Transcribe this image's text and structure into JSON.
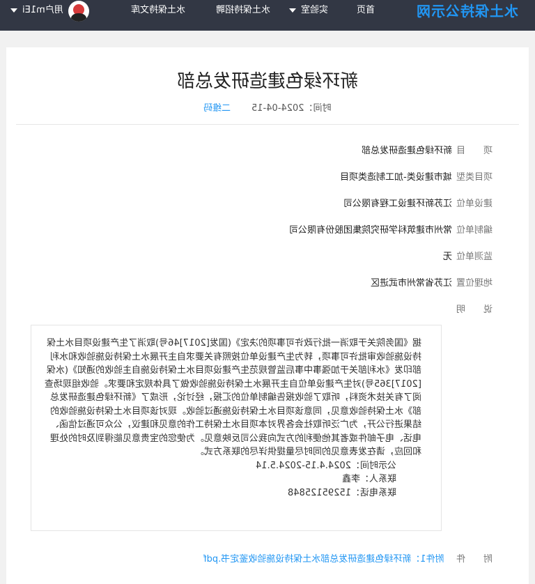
{
  "nav": {
    "site_name": "水土保持公示网",
    "home": "首页",
    "lab": "实验室",
    "recruit": "水土保持招聘",
    "library": "水土保持文库",
    "user": "用户m1Ei"
  },
  "article": {
    "title": "新环绿色建造研发总部",
    "time_label": "时间：2024-04-15",
    "qrcode": "二维码",
    "rows": [
      {
        "label": "项　　目",
        "value": "新环绿色建造研发总部"
      },
      {
        "label": "项目类型",
        "value": "城市建设类-加工制造类项目"
      },
      {
        "label": "建设单位",
        "value": "江苏新环建设工程有限公司"
      },
      {
        "label": "编制单位",
        "value": "常州市建筑科学研究院集团股份有限公司"
      },
      {
        "label": "监测单位",
        "value": "无"
      },
      {
        "label": "地理位置",
        "value": "江苏省常州市武进区"
      },
      {
        "label": "说　　明",
        "value": ""
      }
    ],
    "description": "据《国务院关于取消一批行政许可事项的决定》(国发[2017]46号)取消了生产建设项目水土保持设施验收审批许可事项，转为生产建设单位按照有关要求自主开展水土保持设施验收和水利部印发《水利部关于加强事中事后监管规范生产建设项目水土保持设施自主验收的通知》(水保[2017]365号)对生产建设单位自主开展水土保持设施验收做了具体规定和要求。验收组现场查阅了有关技术资料，听取了验收报告编制单位的汇报，经讨论，形成了《新环绿色建造研发总部》水土保持验收意见，同意该项目水土保持设施通过验收。现对该项目水土保持设施验收的结果进行公开，为广泛听取社会各界对本项目水土保持工作的意见和建议，公众可通过信函、电话、电子邮件或者其他便利的方式向我公司反映意见。为使您的宝贵意见能得到及时的处理和回应，请在发表意见的同时尽量提供详尽的联系方式。",
    "publicity": "公示时间：2024.4.15-2024.5.14",
    "contact": "联系人：李鑫",
    "phone": "联系电话：15295125848",
    "attachment_label": "附　　件",
    "attachment_link": "附件1：新环绿色建造研发总部水土保持设施验收鉴定书.pdf"
  }
}
